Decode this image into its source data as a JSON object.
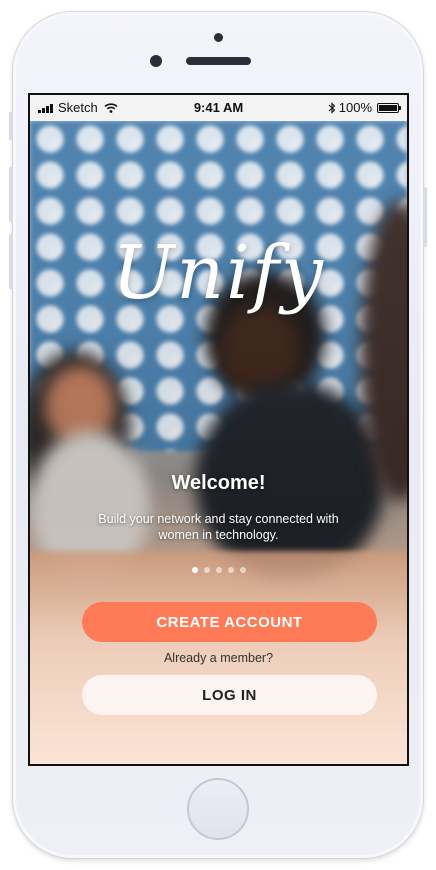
{
  "status_bar": {
    "carrier": "Sketch",
    "time": "9:41 AM",
    "battery": "100%"
  },
  "brand": {
    "logo": "Unify"
  },
  "onboarding": {
    "title": "Welcome!",
    "tagline": "Build your network and stay connected with women in technology.",
    "pages_total": 5,
    "page_current": 1
  },
  "actions": {
    "create_account_label": "CREATE ACCOUNT",
    "already_member": "Already a member?",
    "login_label": "LOG IN"
  },
  "colors": {
    "accent": "#ff7a56",
    "login_bg": "#fbf4f1"
  },
  "icons": [
    "signal-icon",
    "wifi-icon",
    "bluetooth-icon",
    "battery-icon"
  ]
}
